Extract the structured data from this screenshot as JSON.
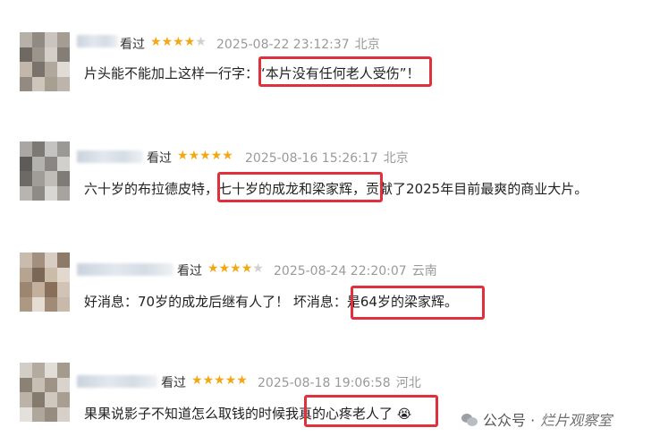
{
  "comments": [
    {
      "status": "看过",
      "rating": 4,
      "timestamp": "2025-08-22 23:12:37",
      "location": "北京",
      "text_before": "片头能不能加上这样一行字：",
      "text_highlight": "“本片没有任何老人受伤”！",
      "text_after": ""
    },
    {
      "status": "看过",
      "rating": 5,
      "timestamp": "2025-08-16 15:26:17",
      "location": "北京",
      "text_before": "六十岁的布拉德皮特，",
      "text_highlight": "七十岁的成龙和梁家辉，",
      "text_after": "贡献了2025年目前最爽的商业大片。"
    },
    {
      "status": "看过",
      "rating": 4,
      "timestamp": "2025-08-24 22:20:07",
      "location": "云南",
      "text_before": "好消息：70岁的成龙后继有人了！ 坏消息：",
      "text_highlight": "是64岁的梁家辉。",
      "text_after": ""
    },
    {
      "status": "看过",
      "rating": 5,
      "timestamp": "2025-08-18 19:06:58",
      "location": "河北",
      "text_before": "果果说影子不知道怎么取钱的时候我",
      "text_highlight": "真的心疼老人了",
      "text_after": "",
      "emoji": "😭"
    }
  ],
  "star_glyph": "★",
  "watermark": {
    "prefix": "公众号 · ",
    "name": "烂片观察室",
    "icon": "wechat-icon"
  },
  "colors": {
    "star": "#f3a712",
    "star_off": "#cfcfcf",
    "highlight_border": "#e0303b",
    "meta": "#9a9a9a"
  }
}
